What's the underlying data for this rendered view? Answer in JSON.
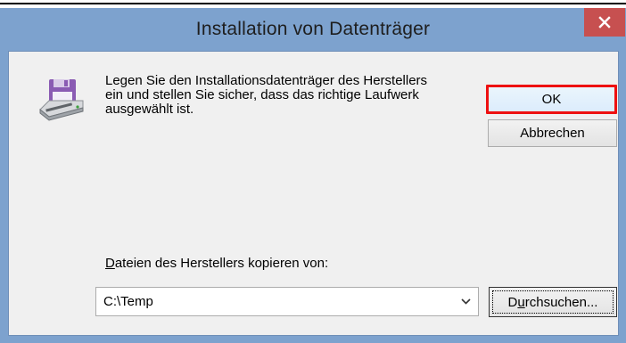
{
  "window": {
    "title": "Installation von Datenträger"
  },
  "message": {
    "lines": [
      "Legen Sie den Installationsdatenträger des Herstellers",
      "ein und stellen Sie sicher, dass das richtige Laufwerk",
      "ausgewählt ist."
    ]
  },
  "buttons": {
    "ok_label": "OK",
    "cancel_label": "Abbrechen",
    "browse_prefix": "D",
    "browse_underlined": "u",
    "browse_rest": "rchsuchen..."
  },
  "copy_from": {
    "label_underlined": "D",
    "label_rest": "ateien des Herstellers kopieren von:",
    "value": "C:\\Temp"
  },
  "icons": {
    "disk": "disk-drive-icon",
    "close": "close-icon",
    "dropdown": "chevron-down-icon"
  },
  "colors": {
    "title_bar": "#7da2ce",
    "close_button": "#c75050",
    "highlight_box": "#ee1010"
  }
}
